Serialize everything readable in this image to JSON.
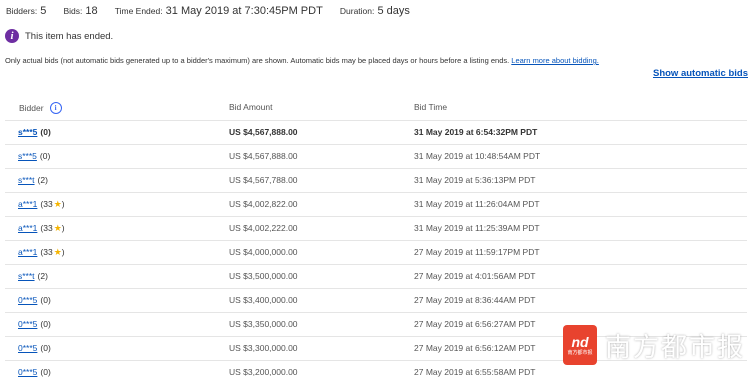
{
  "summary": {
    "bidders_label": "Bidders:",
    "bidders": "5",
    "bids_label": "Bids:",
    "bids": "18",
    "time_ended_label": "Time Ended:",
    "time_ended": "31 May 2019 at 7:30:45PM PDT",
    "duration_label": "Duration:",
    "duration": "5 days"
  },
  "ended_message": "This item has ended.",
  "note": {
    "text": "Only actual bids (not automatic bids generated up to a bidder's maximum) are shown. Automatic bids may be placed days or hours before a listing ends.",
    "link": "Learn more about bidding."
  },
  "show_automatic": "Show automatic bids",
  "columns": {
    "bidder": "Bidder",
    "amount": "Bid Amount",
    "time": "Bid Time"
  },
  "bids": [
    {
      "name": "s***5",
      "fb": "(0)",
      "star": false,
      "amount": "US $4,567,888.00",
      "time": "31 May 2019 at 6:54:32PM PDT",
      "bold": true
    },
    {
      "name": "s***5",
      "fb": "(0)",
      "star": false,
      "amount": "US $4,567,888.00",
      "time": "31 May 2019 at 10:48:54AM PDT",
      "bold": false
    },
    {
      "name": "s***t",
      "fb": "(2)",
      "star": false,
      "amount": "US $4,567,788.00",
      "time": "31 May 2019 at 5:36:13PM PDT",
      "bold": false
    },
    {
      "name": "a***1",
      "fb": "(33",
      "star": true,
      "amount": "US $4,002,822.00",
      "time": "31 May 2019 at 11:26:04AM PDT",
      "bold": false
    },
    {
      "name": "a***1",
      "fb": "(33",
      "star": true,
      "amount": "US $4,002,222.00",
      "time": "31 May 2019 at 11:25:39AM PDT",
      "bold": false
    },
    {
      "name": "a***1",
      "fb": "(33",
      "star": true,
      "amount": "US $4,000,000.00",
      "time": "27 May 2019 at 11:59:17PM PDT",
      "bold": false
    },
    {
      "name": "s***t",
      "fb": "(2)",
      "star": false,
      "amount": "US $3,500,000.00",
      "time": "27 May 2019 at 4:01:56AM PDT",
      "bold": false
    },
    {
      "name": "0***5",
      "fb": "(0)",
      "star": false,
      "amount": "US $3,400,000.00",
      "time": "27 May 2019 at 8:36:44AM PDT",
      "bold": false
    },
    {
      "name": "0***5",
      "fb": "(0)",
      "star": false,
      "amount": "US $3,350,000.00",
      "time": "27 May 2019 at 6:56:27AM PDT",
      "bold": false
    },
    {
      "name": "0***5",
      "fb": "(0)",
      "star": false,
      "amount": "US $3,300,000.00",
      "time": "27 May 2019 at 6:56:12AM PDT",
      "bold": false
    },
    {
      "name": "0***5",
      "fb": "(0)",
      "star": false,
      "amount": "US $3,200,000.00",
      "time": "27 May 2019 at 6:55:58AM PDT",
      "bold": false
    }
  ],
  "watermark": {
    "logo_mark": "nd",
    "logo_sub": "南方都市报",
    "text": "南方都市报"
  },
  "colors": {
    "link": "#0654ba",
    "info": "#6e2ea2",
    "star": "#f5b400",
    "watermark": "#e8432e"
  }
}
